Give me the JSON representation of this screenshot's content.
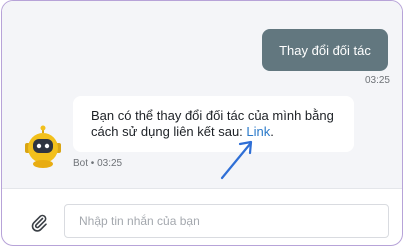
{
  "messages": {
    "user": {
      "text": "Thay đổi đối tác",
      "time": "03:25"
    },
    "bot": {
      "text_before": "Bạn có thể thay đổi đối tác của mình bằng cách sử dụng liên kết sau: ",
      "link_text": "Link",
      "text_after": ".",
      "meta": "Bot • 03:25"
    }
  },
  "composer": {
    "placeholder": "Nhập tin nhắn của bạn"
  },
  "colors": {
    "frame_border": "#b7a3d8",
    "user_bubble": "#62777f",
    "link": "#2a79c9",
    "arrow": "#2f6fd6",
    "avatar_yellow": "#f2c01c"
  },
  "icons": {
    "attach": "paperclip-icon",
    "avatar": "robot-avatar-icon",
    "annotation": "arrow-icon"
  }
}
